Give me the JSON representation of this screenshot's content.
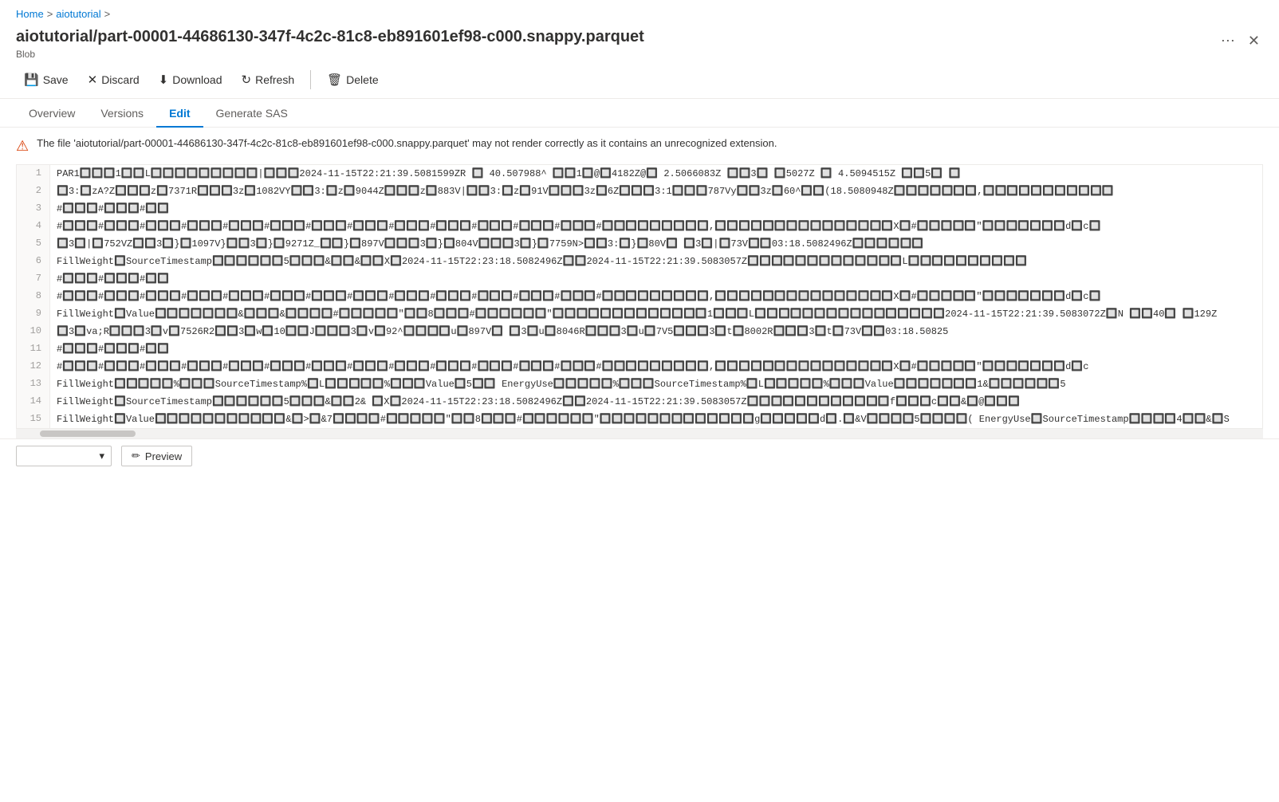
{
  "breadcrumb": {
    "home": "Home",
    "separator1": ">",
    "tutorial": "aiotutorial",
    "separator2": ">"
  },
  "header": {
    "title": "aiotutorial/part-00001-44686130-347f-4c2c-81c8-eb891601ef98-c000.snappy.parquet",
    "subtitle": "Blob",
    "more_label": "⋯",
    "close_label": "✕"
  },
  "toolbar": {
    "save_label": "Save",
    "discard_label": "Discard",
    "download_label": "Download",
    "refresh_label": "Refresh",
    "delete_label": "Delete"
  },
  "tabs": [
    {
      "id": "overview",
      "label": "Overview",
      "active": false
    },
    {
      "id": "versions",
      "label": "Versions",
      "active": false
    },
    {
      "id": "edit",
      "label": "Edit",
      "active": true
    },
    {
      "id": "generate-sas",
      "label": "Generate SAS",
      "active": false
    }
  ],
  "warning": {
    "icon": "⚠",
    "message": "The file 'aiotutorial/part-00001-44686130-347f-4c2c-81c8-eb891601ef98-c000.snappy.parquet' may not render correctly as it contains an unrecognized extension."
  },
  "editor": {
    "lines": [
      {
        "num": 1,
        "content": "PAR1🔲🔲🔲1🔲🔲L🔲🔲🔲🔲🔲🔲🔲🔲🔲|🔲🔲🔲2024-11-15T22:21:39.5081599ZR 🔲 40.507988^ 🔲🔲1🔲@🔲4182Z@🔲 2.5066083Z 🔲🔲3🔲 🔲5027Z 🔲 4.5094515Z 🔲🔲5🔲 🔲"
      },
      {
        "num": 2,
        "content": "🔲3:🔲zA?Z🔲🔲🔲z🔲7371R🔲🔲🔲3z🔲1082VY🔲🔲3:🔲z🔲9044Z🔲🔲🔲z🔲883V|🔲🔲3:🔲z🔲91V🔲🔲🔲3z🔲6Z🔲🔲🔲3:1🔲🔲🔲787Vy🔲🔲3z🔲60^🔲🔲(18.5080948Z🔲🔲🔲🔲🔲🔲🔲,🔲🔲🔲🔲🔲🔲🔲🔲🔲🔲🔲"
      },
      {
        "num": 3,
        "content": "#🔲🔲🔲#🔲🔲🔲#🔲🔲"
      },
      {
        "num": 4,
        "content": "#🔲🔲🔲#🔲🔲🔲#🔲🔲🔲#🔲🔲🔲#🔲🔲🔲#🔲🔲🔲#🔲🔲🔲#🔲🔲🔲#🔲🔲🔲#🔲🔲🔲#🔲🔲🔲#🔲🔲🔲#🔲🔲🔲#🔲🔲🔲🔲🔲🔲🔲🔲🔲,🔲🔲🔲🔲🔲🔲🔲🔲🔲🔲🔲🔲🔲🔲🔲X🔲#🔲🔲🔲🔲🔲\"🔲🔲🔲🔲🔲🔲🔲d🔲c🔲"
      },
      {
        "num": 5,
        "content": "🔲3🔲|🔲752VZ🔲🔲3🔲}🔲1097V}🔲🔲3🔲}🔲9271Z_🔲🔲}🔲897V🔲🔲🔲3🔲}🔲804V🔲🔲🔲3🔲}🔲7759N>🔲🔲3:🔲}🔲80V🔲   🔲3🔲|🔲73V🔲🔲03:18.5082496Z🔲🔲🔲🔲🔲🔲"
      },
      {
        "num": 6,
        "content": "FillWeight🔲SourceTimestamp🔲🔲🔲🔲🔲🔲5🔲🔲🔲&🔲🔲&🔲🔲X🔲2024-11-15T22:23:18.5082496Z🔲🔲2024-11-15T22:21:39.5083057Z🔲🔲🔲🔲🔲🔲🔲🔲🔲🔲🔲🔲🔲L🔲🔲🔲🔲🔲🔲🔲🔲🔲🔲"
      },
      {
        "num": 7,
        "content": "#🔲🔲🔲#🔲🔲🔲#🔲🔲"
      },
      {
        "num": 8,
        "content": "#🔲🔲🔲#🔲🔲🔲#🔲🔲🔲#🔲🔲🔲#🔲🔲🔲#🔲🔲🔲#🔲🔲🔲#🔲🔲🔲#🔲🔲🔲#🔲🔲🔲#🔲🔲🔲#🔲🔲🔲#🔲🔲🔲#🔲🔲🔲🔲🔲🔲🔲🔲🔲,🔲🔲🔲🔲🔲🔲🔲🔲🔲🔲🔲🔲🔲🔲🔲X🔲#🔲🔲🔲🔲🔲\"🔲🔲🔲🔲🔲🔲🔲d🔲c🔲"
      },
      {
        "num": 9,
        "content": "FillWeight🔲Value🔲🔲🔲🔲🔲🔲🔲&🔲🔲🔲&🔲🔲🔲🔲#🔲🔲🔲🔲🔲\"🔲🔲8🔲🔲🔲#🔲🔲🔲🔲🔲🔲\"🔲🔲🔲🔲🔲🔲🔲🔲🔲🔲🔲🔲🔲1🔲🔲🔲L🔲🔲🔲🔲🔲🔲🔲🔲🔲🔲🔲🔲🔲🔲🔲🔲2024-11-15T22:21:39.5083072Z🔲N 🔲🔲40🔲 🔲129Z"
      },
      {
        "num": 10,
        "content": "🔲3🔲va;R🔲🔲🔲3🔲v🔲7526R2🔲🔲3🔲w🔲10🔲🔲J🔲🔲🔲3🔲v🔲92^🔲🔲🔲🔲u🔲897V🔲 🔲3🔲u🔲8046R🔲🔲🔲3🔲u🔲7V5🔲🔲🔲3🔲t🔲8002R🔲🔲🔲3🔲t🔲73V🔲🔲03:18.50825"
      },
      {
        "num": 11,
        "content": "#🔲🔲🔲#🔲🔲🔲#🔲🔲"
      },
      {
        "num": 12,
        "content": "#🔲🔲🔲#🔲🔲🔲#🔲🔲🔲#🔲🔲🔲#🔲🔲🔲#🔲🔲🔲#🔲🔲🔲#🔲🔲🔲#🔲🔲🔲#🔲🔲🔲#🔲🔲🔲#🔲🔲🔲#🔲🔲🔲#🔲🔲🔲🔲🔲🔲🔲🔲🔲,🔲🔲🔲🔲🔲🔲🔲🔲🔲🔲🔲🔲🔲🔲🔲X🔲#🔲🔲🔲🔲🔲\"🔲🔲🔲🔲🔲🔲🔲d🔲c"
      },
      {
        "num": 13,
        "content": "FillWeight🔲🔲🔲🔲🔲%🔲🔲🔲SourceTimestamp%🔲L🔲🔲🔲🔲🔲%🔲🔲🔲Value🔲5🔲🔲    EnergyUse🔲🔲🔲🔲🔲%🔲🔲🔲SourceTimestamp%🔲L🔲🔲🔲🔲🔲%🔲🔲🔲Value🔲🔲🔲🔲🔲🔲🔲1&🔲🔲🔲🔲🔲🔲5"
      },
      {
        "num": 14,
        "content": "FillWeight🔲SourceTimestamp🔲🔲🔲🔲🔲🔲5🔲🔲🔲&🔲🔲2&   🔲X🔲2024-11-15T22:23:18.5082496Z🔲🔲2024-11-15T22:21:39.5083057Z🔲🔲🔲🔲🔲🔲🔲🔲🔲🔲🔲🔲f🔲🔲🔲c🔲🔲&🔲@🔲🔲🔲"
      },
      {
        "num": 15,
        "content": "FillWeight🔲Value🔲🔲🔲🔲🔲🔲🔲🔲🔲🔲🔲&🔲>🔲&7🔲🔲🔲🔲#🔲🔲🔲🔲🔲\"🔲🔲8🔲🔲🔲#🔲🔲🔲🔲🔲🔲\"🔲🔲🔲🔲🔲🔲🔲🔲🔲🔲🔲🔲🔲g🔲🔲🔲🔲🔲d🔲.🔲&V🔲🔲🔲🔲5🔲🔲🔲🔲(  EnergyUse🔲SourceTimestamp🔲🔲🔲🔲4🔲🔲&🔲S"
      }
    ]
  },
  "bottom_bar": {
    "encoding_placeholder": "",
    "encoding_chevron": "▾",
    "preview_icon": "✏",
    "preview_label": "Preview"
  }
}
